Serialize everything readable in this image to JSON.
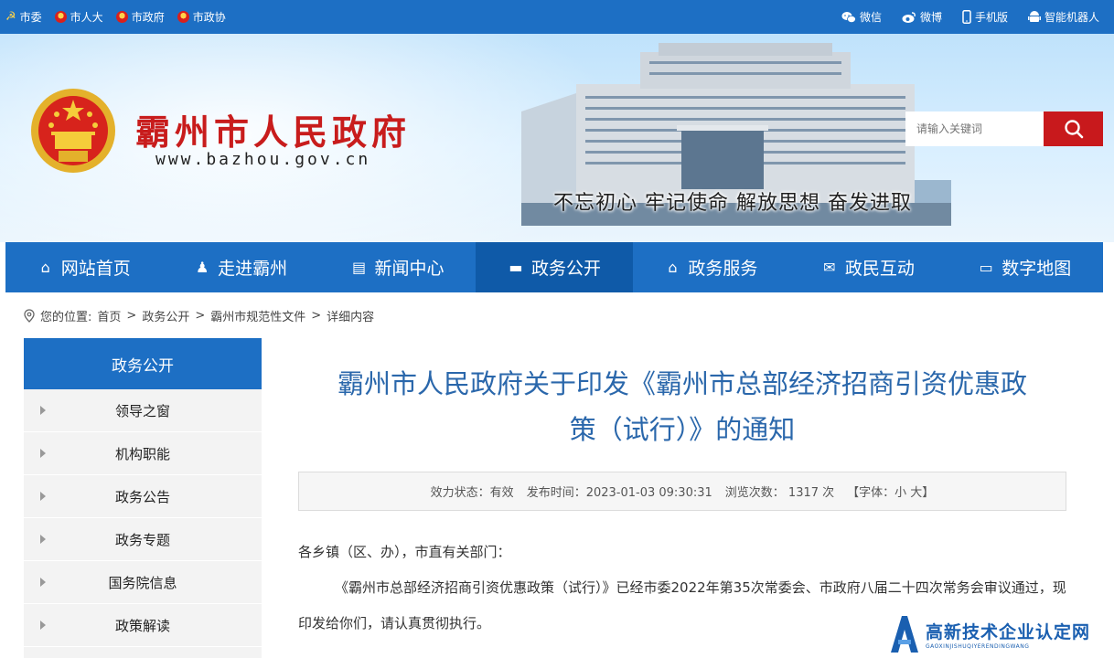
{
  "topbar": {
    "left_links": [
      "市委",
      "市人大",
      "市政府",
      "市政协"
    ],
    "wechat": "微信",
    "weibo": "微博",
    "mobile": "手机版",
    "robot": "智能机器人"
  },
  "banner": {
    "site_name": "霸州市人民政府",
    "site_url": "www.bazhou.gov.cn",
    "slogan": "不忘初心  牢记使命  解放思想  奋发进取",
    "search_placeholder": "请输入关键词"
  },
  "nav": [
    {
      "label": "网站首页",
      "icon": "home-icon"
    },
    {
      "label": "走进霸州",
      "icon": "person-pin-icon"
    },
    {
      "label": "新闻中心",
      "icon": "document-icon"
    },
    {
      "label": "政务公开",
      "icon": "folder-icon",
      "active": true
    },
    {
      "label": "政务服务",
      "icon": "home-icon"
    },
    {
      "label": "政民互动",
      "icon": "mail-icon"
    },
    {
      "label": "数字地图",
      "icon": "monitor-icon"
    }
  ],
  "breadcrumb": {
    "prefix": "您的位置:",
    "items": [
      "首页",
      "政务公开",
      "霸州市规范性文件",
      "详细内容"
    ],
    "sep": ">"
  },
  "sidebar": {
    "title": "政务公开",
    "items": [
      "领导之窗",
      "机构职能",
      "政务公告",
      "政务专题",
      "国务院信息",
      "政策解读"
    ]
  },
  "article": {
    "title_line1": "霸州市人民政府关于印发《霸州市总部经济招商引资优惠政",
    "title_line2": "策（试行）》的通知",
    "meta_status": "效力状态：有效",
    "meta_date": "发布时间：2023-01-03 09:30:31",
    "meta_views_label": "浏览次数：",
    "meta_views": "1317",
    "meta_views_unit": "次",
    "meta_font": "【字体：小 大】",
    "para1": "各乡镇（区、办），市直有关部门：",
    "para2": "《霸州市总部经济招商引资优惠政策（试行）》已经市委2022年第35次常委会、市政府八届二十四次常务会审议通过，现印发给你们，请认真贯彻执行。"
  },
  "watermark": {
    "main": "高新技术企业认定网",
    "sub": "GAOXINJISHUQIYERENDINGWANG"
  },
  "colors": {
    "primary_blue": "#1d6fc4",
    "active_blue": "#0f5aa8",
    "brand_red": "#c81c1c",
    "title_blue": "#2a67ab"
  }
}
